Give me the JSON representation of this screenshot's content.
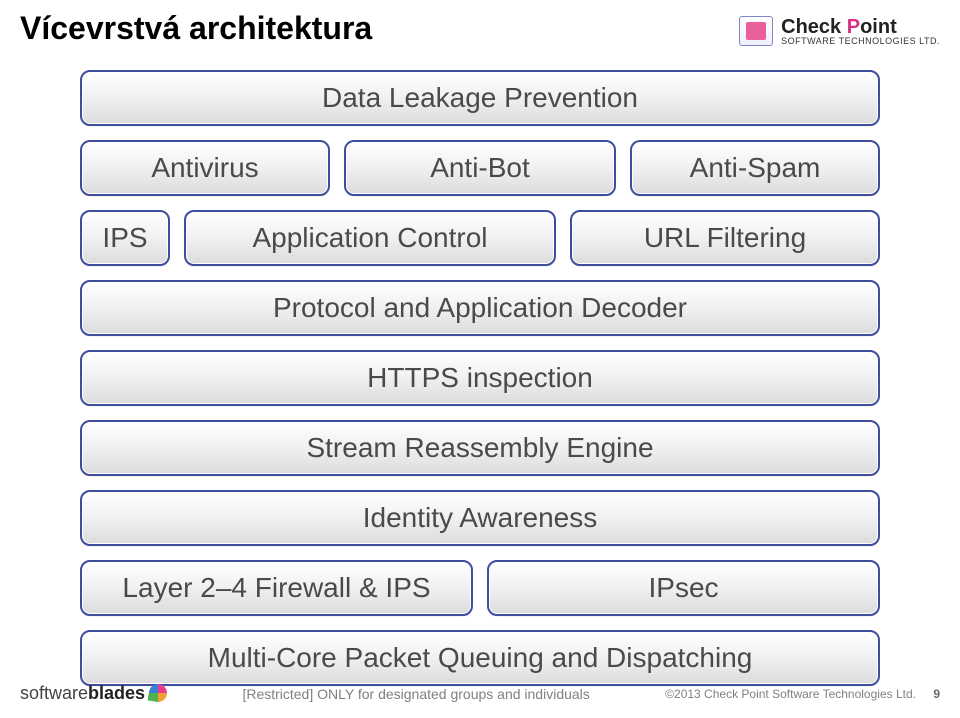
{
  "header": {
    "title": "Vícevrstvá architektura",
    "logo_main_pre": "Check ",
    "logo_main_accent": "P",
    "logo_main_post": "oint",
    "logo_sub": "SOFTWARE TECHNOLOGIES LTD."
  },
  "rows": {
    "r1_dlp": "Data Leakage Prevention",
    "r2_av": "Antivirus",
    "r2_abot": "Anti-Bot",
    "r2_aspam": "Anti-Spam",
    "r3_ips": "IPS",
    "r3_appc": "Application Control",
    "r3_url": "URL Filtering",
    "r4_proto": "Protocol and Application Decoder",
    "r5_https": "HTTPS inspection",
    "r6_stream": "Stream Reassembly Engine",
    "r7_ident": "Identity Awareness",
    "r8_fw": "Layer 2–4 Firewall & IPS",
    "r8_ipsec": "IPsec",
    "r9_mc": "Multi-Core Packet Queuing and Dispatching"
  },
  "footer": {
    "softwareblades_a": "software",
    "softwareblades_b": "blades",
    "restricted": "[Restricted] ONLY for designated groups and individuals",
    "copyright": "©2013 Check Point Software Technologies Ltd.",
    "page_no": "9"
  }
}
